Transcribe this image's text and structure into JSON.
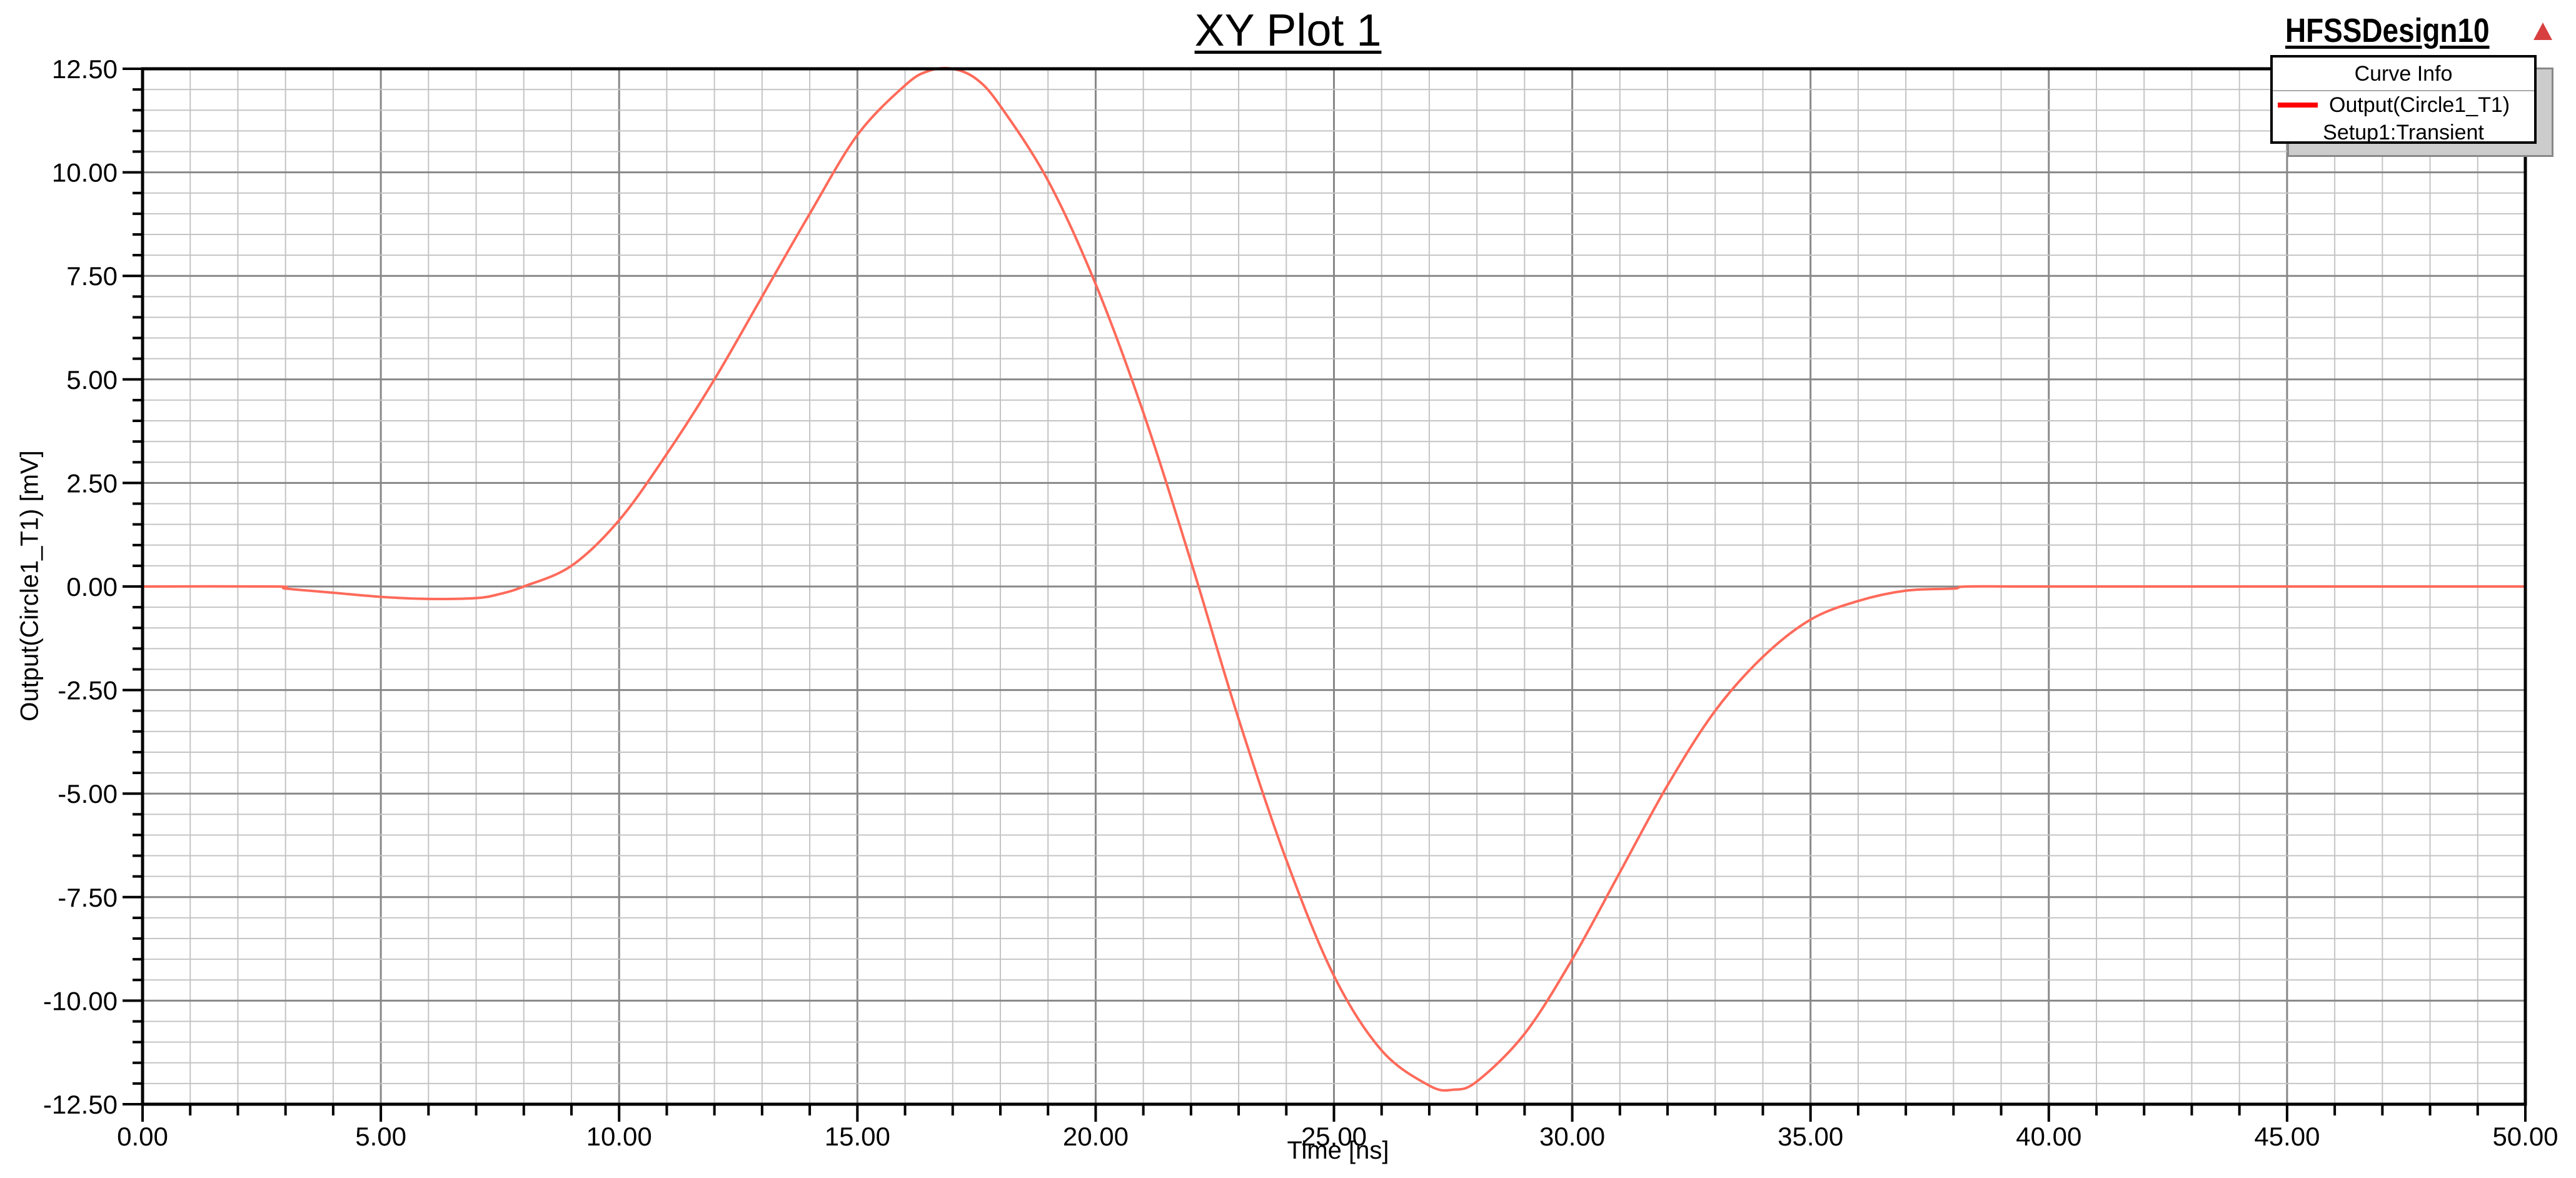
{
  "chart_data": {
    "type": "line",
    "title": "XY Plot 1",
    "design_name": "HFSSDesign10",
    "xlabel": "Time [ns]",
    "ylabel": "Output(Circle1_T1) [mV]",
    "xlim": [
      0,
      50
    ],
    "ylim": [
      -12.5,
      12.5
    ],
    "x_major_step": 5,
    "x_minor_step": 1,
    "y_major_step": 2.5,
    "y_minor_step": 0.5,
    "grid": true,
    "x_tick_labels": [
      "0.00",
      "5.00",
      "10.00",
      "15.00",
      "20.00",
      "25.00",
      "30.00",
      "35.00",
      "40.00",
      "45.00",
      "50.00"
    ],
    "y_tick_labels": [
      "12.50",
      "10.00",
      "7.50",
      "5.00",
      "2.50",
      "0.00",
      "-2.50",
      "-5.00",
      "-7.50",
      "-10.00",
      "-12.50"
    ],
    "legend": {
      "title": "Curve Info",
      "placement": "top-right",
      "entries": [
        {
          "name": "Output(Circle1_T1)",
          "sub": "Setup1:Transient",
          "color": "#ff0000"
        }
      ]
    },
    "series": [
      {
        "name": "Output(Circle1_T1)",
        "color": "#ff6a5a",
        "x": [
          0,
          2.8,
          3,
          4,
          5,
          6,
          7,
          7.5,
          8,
          9,
          10,
          11,
          12,
          13,
          14,
          15,
          16,
          16.5,
          17,
          17.5,
          18,
          19,
          20,
          21,
          22,
          23,
          24,
          25,
          26,
          27,
          27.5,
          28,
          29,
          30,
          31,
          32,
          33,
          34,
          35,
          36,
          37,
          38,
          38.3,
          40,
          45,
          50
        ],
        "y": [
          0,
          0,
          -0.05,
          -0.15,
          -0.25,
          -0.3,
          -0.28,
          -0.18,
          0,
          0.5,
          1.6,
          3.2,
          5.0,
          7.0,
          9.0,
          10.9,
          12.1,
          12.45,
          12.5,
          12.25,
          11.6,
          9.8,
          7.3,
          4.2,
          0.6,
          -3.2,
          -6.6,
          -9.4,
          -11.2,
          -12.05,
          -12.15,
          -11.95,
          -10.8,
          -9.0,
          -6.9,
          -4.8,
          -3.0,
          -1.7,
          -0.8,
          -0.35,
          -0.1,
          -0.05,
          0,
          0,
          0,
          0
        ]
      }
    ]
  }
}
